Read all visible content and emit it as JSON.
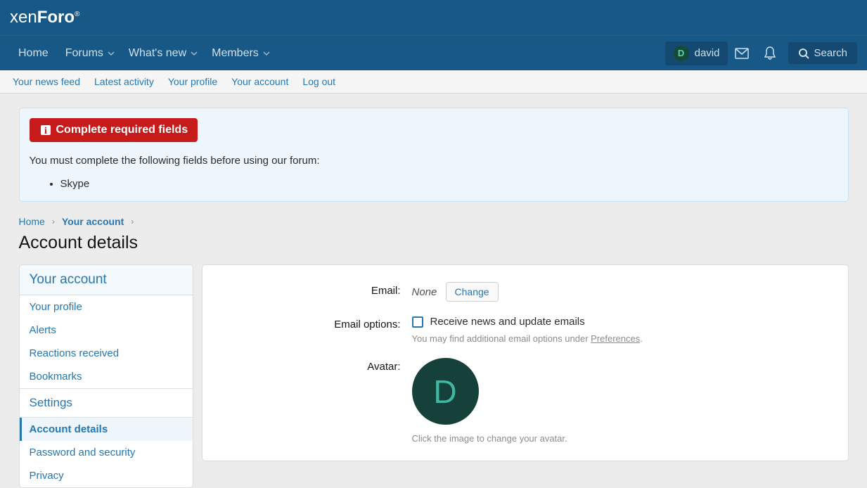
{
  "logo": {
    "xen": "xen",
    "foro": "Foro"
  },
  "nav": {
    "items": [
      {
        "label": "Home",
        "toggle": false
      },
      {
        "label": "Forums",
        "toggle": true
      },
      {
        "label": "What's new",
        "toggle": true
      },
      {
        "label": "Members",
        "toggle": true
      }
    ]
  },
  "user": {
    "name": "david",
    "initial": "D"
  },
  "search": {
    "label": "Search"
  },
  "subnav": [
    {
      "label": "Your news feed"
    },
    {
      "label": "Latest activity"
    },
    {
      "label": "Your profile"
    },
    {
      "label": "Your account"
    },
    {
      "label": "Log out"
    }
  ],
  "notice": {
    "badge": "Complete required fields",
    "message": "You must complete the following fields before using our forum:",
    "fields": [
      "Skype"
    ]
  },
  "breadcrumbs": {
    "home": "Home",
    "current": "Your account"
  },
  "page_title": "Account details",
  "sidebar": {
    "heading1": "Your account",
    "group1": [
      {
        "label": "Your profile"
      },
      {
        "label": "Alerts"
      },
      {
        "label": "Reactions received"
      },
      {
        "label": "Bookmarks"
      }
    ],
    "heading2": "Settings",
    "group2": [
      {
        "label": "Account details",
        "active": true
      },
      {
        "label": "Password and security"
      },
      {
        "label": "Privacy"
      }
    ]
  },
  "form": {
    "email": {
      "label": "Email:",
      "value": "None",
      "change": "Change"
    },
    "email_options": {
      "label": "Email options:",
      "checkbox_label": "Receive news and update emails",
      "hint_pre": "You may find additional email options under ",
      "hint_link": "Preferences",
      "hint_post": "."
    },
    "avatar": {
      "label": "Avatar:",
      "initial": "D",
      "hint": "Click the image to change your avatar."
    }
  }
}
